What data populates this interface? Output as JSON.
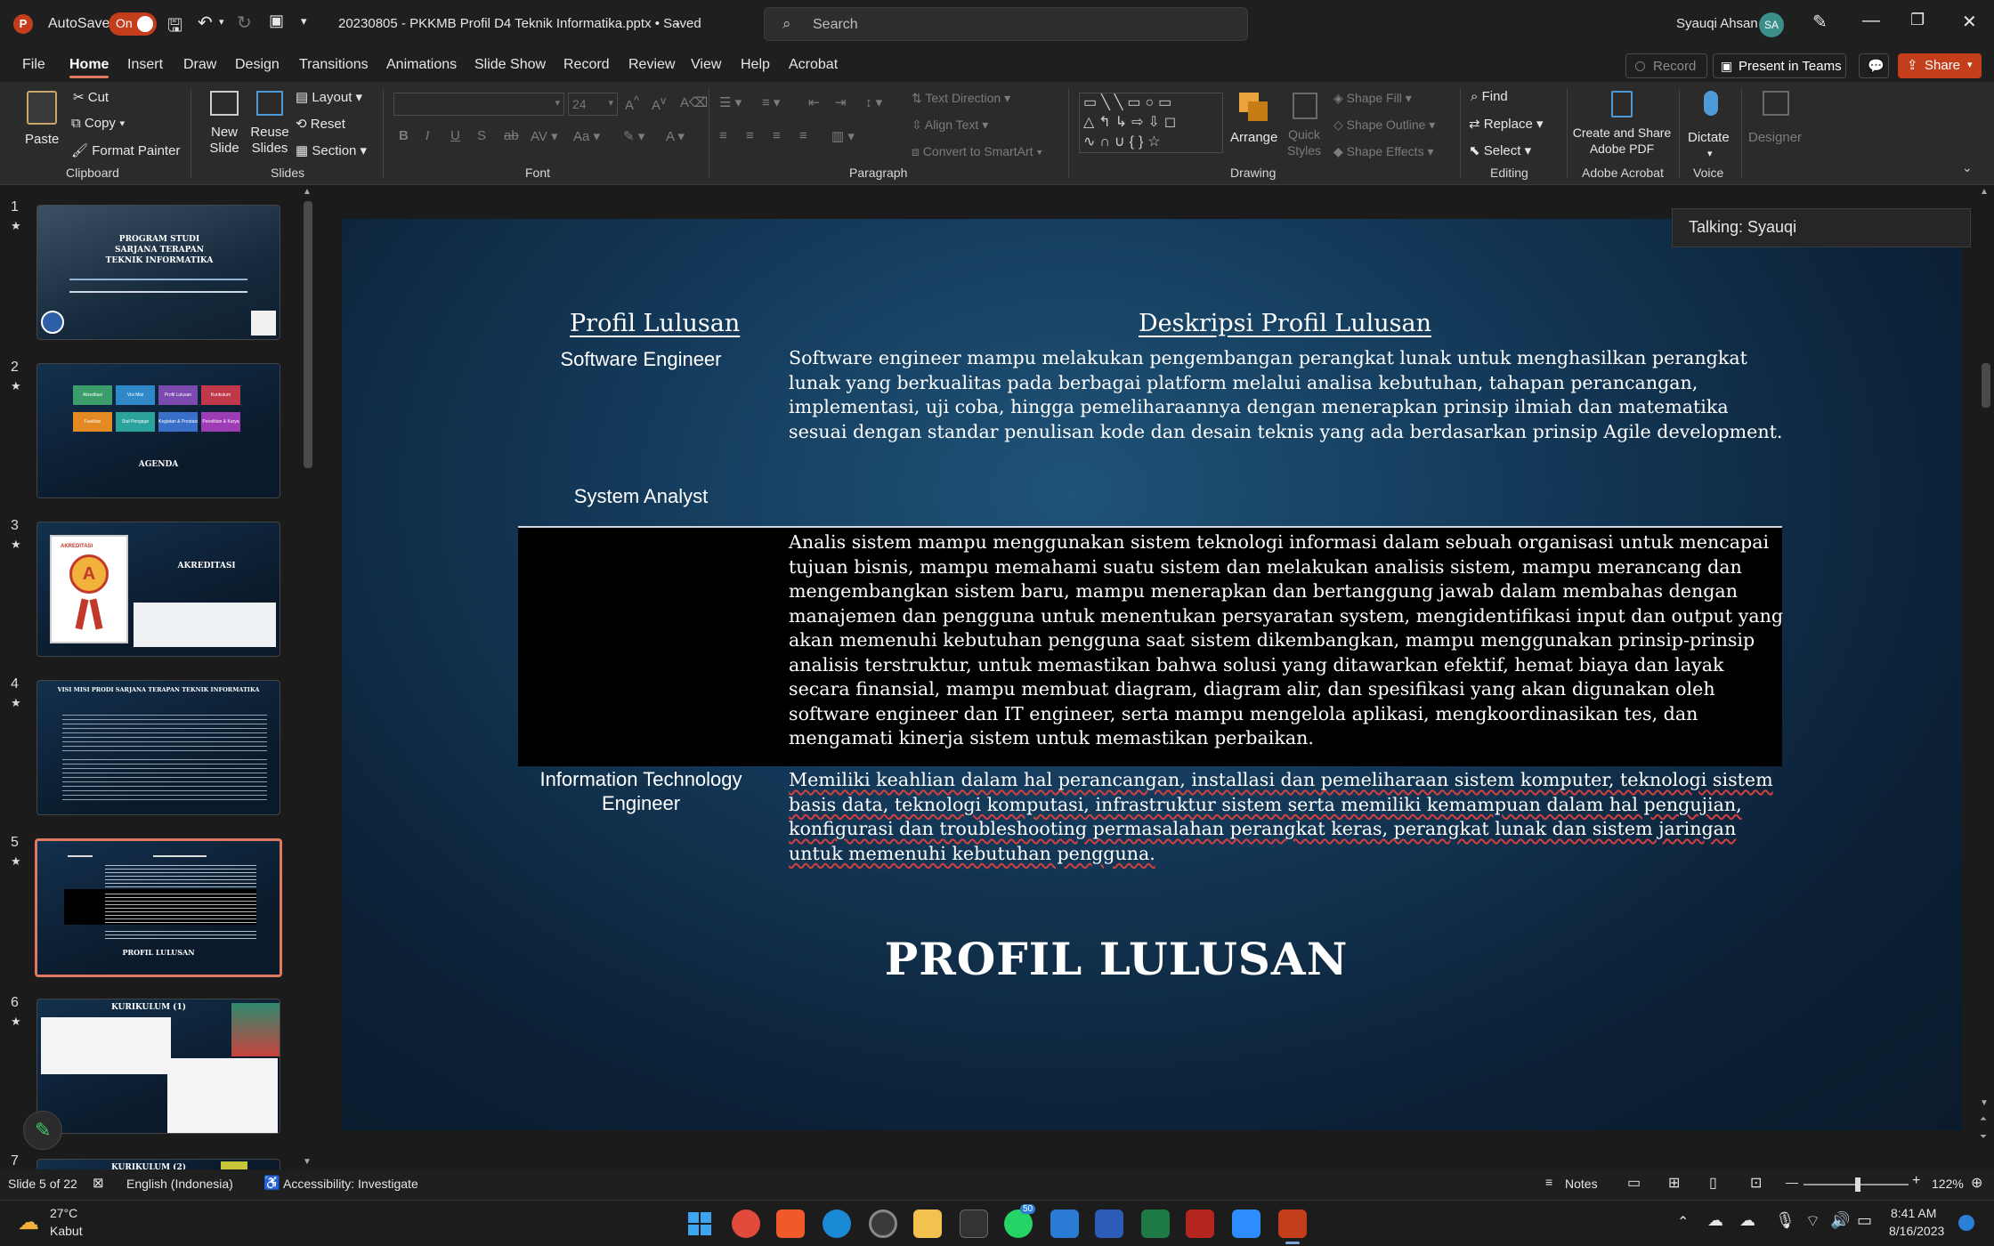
{
  "app": {
    "autosave_label": "AutoSave",
    "autosave_state": "On",
    "doc_title": "20230805 - PKKMB Profil D4 Teknik Informatika.pptx • Saved",
    "search_placeholder": "Search",
    "user_name": "Syauqi Ahsan",
    "user_initials": "SA"
  },
  "menu": {
    "tabs": [
      "File",
      "Home",
      "Insert",
      "Draw",
      "Design",
      "Transitions",
      "Animations",
      "Slide Show",
      "Record",
      "Review",
      "View",
      "Help",
      "Acrobat"
    ],
    "active": "Home",
    "record_label": "Record",
    "present_label": "Present in Teams",
    "share_label": "Share"
  },
  "ribbon": {
    "clipboard": {
      "paste": "Paste",
      "cut": "Cut",
      "copy": "Copy",
      "format_painter": "Format Painter",
      "label": "Clipboard"
    },
    "slides": {
      "new_slide": "New Slide",
      "reuse": "Reuse Slides",
      "layout": "Layout",
      "reset": "Reset",
      "section": "Section",
      "label": "Slides"
    },
    "font": {
      "font_size": "24",
      "label": "Font"
    },
    "paragraph": {
      "text_direction": "Text Direction",
      "align_text": "Align Text",
      "convert": "Convert to SmartArt",
      "label": "Paragraph"
    },
    "drawing": {
      "arrange": "Arrange",
      "quick_styles": "Quick Styles",
      "shape_fill": "Shape Fill",
      "shape_outline": "Shape Outline",
      "shape_effects": "Shape Effects",
      "label": "Drawing"
    },
    "editing": {
      "find": "Find",
      "replace": "Replace",
      "select": "Select",
      "label": "Editing"
    },
    "acrobat": {
      "create": "Create and Share Adobe PDF",
      "label": "Adobe Acrobat"
    },
    "voice": {
      "dictate": "Dictate",
      "label": "Voice"
    },
    "designer": {
      "label": "Designer"
    }
  },
  "thumbnails": [
    {
      "num": "1",
      "title": "PROGRAM STUDI SARJANA TERAPAN TEKNIK INFORMATIKA"
    },
    {
      "num": "2",
      "title": "AGENDA",
      "boxes": [
        "Akreditasi",
        "Visi Misi",
        "Profil Lulusan",
        "Kurikulum",
        "Fasilitas Laboratorium",
        "Staf Pengajar",
        "Kegiatan & Prestasi Mahasiswa",
        "Penelitian & Karya"
      ]
    },
    {
      "num": "3",
      "title": "AKREDITASI",
      "badge": "AKREDITASI"
    },
    {
      "num": "4",
      "title": "VISI MISI PRODI SARJANA TERAPAN TEKNIK INFORMATIKA"
    },
    {
      "num": "5",
      "title": "PROFIL LULUSAN"
    },
    {
      "num": "6",
      "title": "KURIKULUM (1)"
    },
    {
      "num": "7",
      "title": "KURIKULUM (2)"
    }
  ],
  "talking": "Talking: Syauqi",
  "slide": {
    "col1": "Profil Lulusan",
    "col2": "Deskripsi Profil Lulusan",
    "rows": [
      {
        "role": "Software Engineer",
        "desc": "Software engineer mampu melakukan pengembangan perangkat lunak untuk menghasilkan perangkat lunak yang berkualitas pada berbagai platform melalui analisa kebutuhan, tahapan perancangan, implementasi, uji coba, hingga pemeliharaannya dengan menerapkan prinsip ilmiah dan matematika sesuai dengan standar penulisan kode dan desain teknis yang ada berdasarkan prinsip Agile development."
      },
      {
        "role": "System Analyst",
        "desc": "Analis sistem mampu menggunakan sistem teknologi informasi dalam sebuah organisasi untuk mencapai tujuan bisnis, mampu memahami suatu sistem dan melakukan analisis sistem, mampu merancang dan mengembangkan sistem baru, mampu menerapkan dan bertanggung jawab dalam membahas dengan manajemen dan pengguna untuk menentukan persyaratan system, mengidentifikasi input dan output yang akan memenuhi kebutuhan pengguna saat sistem dikembangkan, mampu menggunakan prinsip-prinsip analisis terstruktur, untuk memastikan bahwa solusi yang ditawarkan efektif, hemat biaya dan layak secara finansial, mampu membuat diagram, diagram alir, dan spesifikasi yang akan digunakan oleh software engineer dan IT engineer, serta mampu mengelola aplikasi, mengkoordinasikan tes, dan mengamati kinerja sistem untuk memastikan perbaikan."
      },
      {
        "role": "Information Technology Engineer",
        "desc": "Memiliki keahlian dalam hal perancangan, installasi dan pemeliharaan sistem komputer, teknologi sistem basis data, teknologi komputasi, infrastruktur sistem serta memiliki kemampuan dalam hal pengujian, konfigurasi dan troubleshooting permasalahan perangkat keras, perangkat lunak dan sistem jaringan untuk memenuhi kebutuhan pengguna."
      }
    ],
    "footer_title": "PROFIL LULUSAN"
  },
  "status": {
    "slide_count": "Slide 5 of 22",
    "language": "English (Indonesia)",
    "accessibility": "Accessibility: Investigate",
    "notes": "Notes",
    "zoom": "122%"
  },
  "taskbar": {
    "temp": "27°C",
    "weather": "Kabut",
    "time": "8:41 AM",
    "date": "8/16/2023",
    "whatsapp_badge": "50"
  }
}
